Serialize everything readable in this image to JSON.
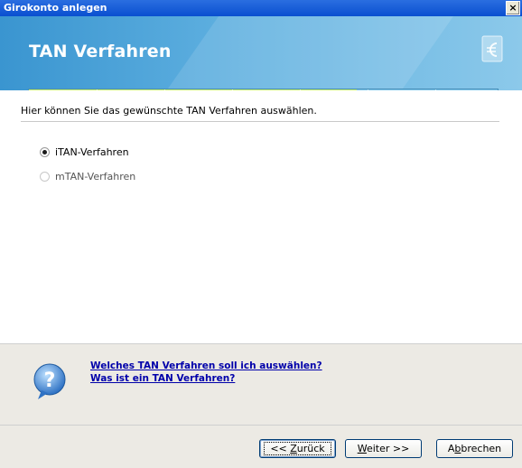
{
  "window": {
    "title": "Girokonto anlegen",
    "close_glyph": "×"
  },
  "banner": {
    "heading": "TAN Verfahren",
    "logo_icon": "euro-document-icon",
    "progress_fraction": 0.7
  },
  "instruction": "Hier können Sie das gewünschte TAN Verfahren auswählen.",
  "options": [
    {
      "label": "iTAN-Verfahren",
      "selected": true
    },
    {
      "label": "mTAN-Verfahren",
      "selected": false
    }
  ],
  "help": {
    "icon": "question-bubble-icon",
    "links": [
      "Welches TAN Verfahren soll ich auswählen?",
      "Was ist ein TAN Verfahren?"
    ]
  },
  "buttons": {
    "back": {
      "prefix": "<< ",
      "mnemonic": "Z",
      "rest": "urück"
    },
    "next": {
      "mnemonic": "W",
      "rest": "eiter >>"
    },
    "cancel": {
      "prefix": "A",
      "mnemonic": "b",
      "rest": "brechen"
    }
  },
  "colors": {
    "titlebar": "#0a4fd0",
    "progress_fill": "#8ccc23",
    "link": "#0000aa"
  }
}
